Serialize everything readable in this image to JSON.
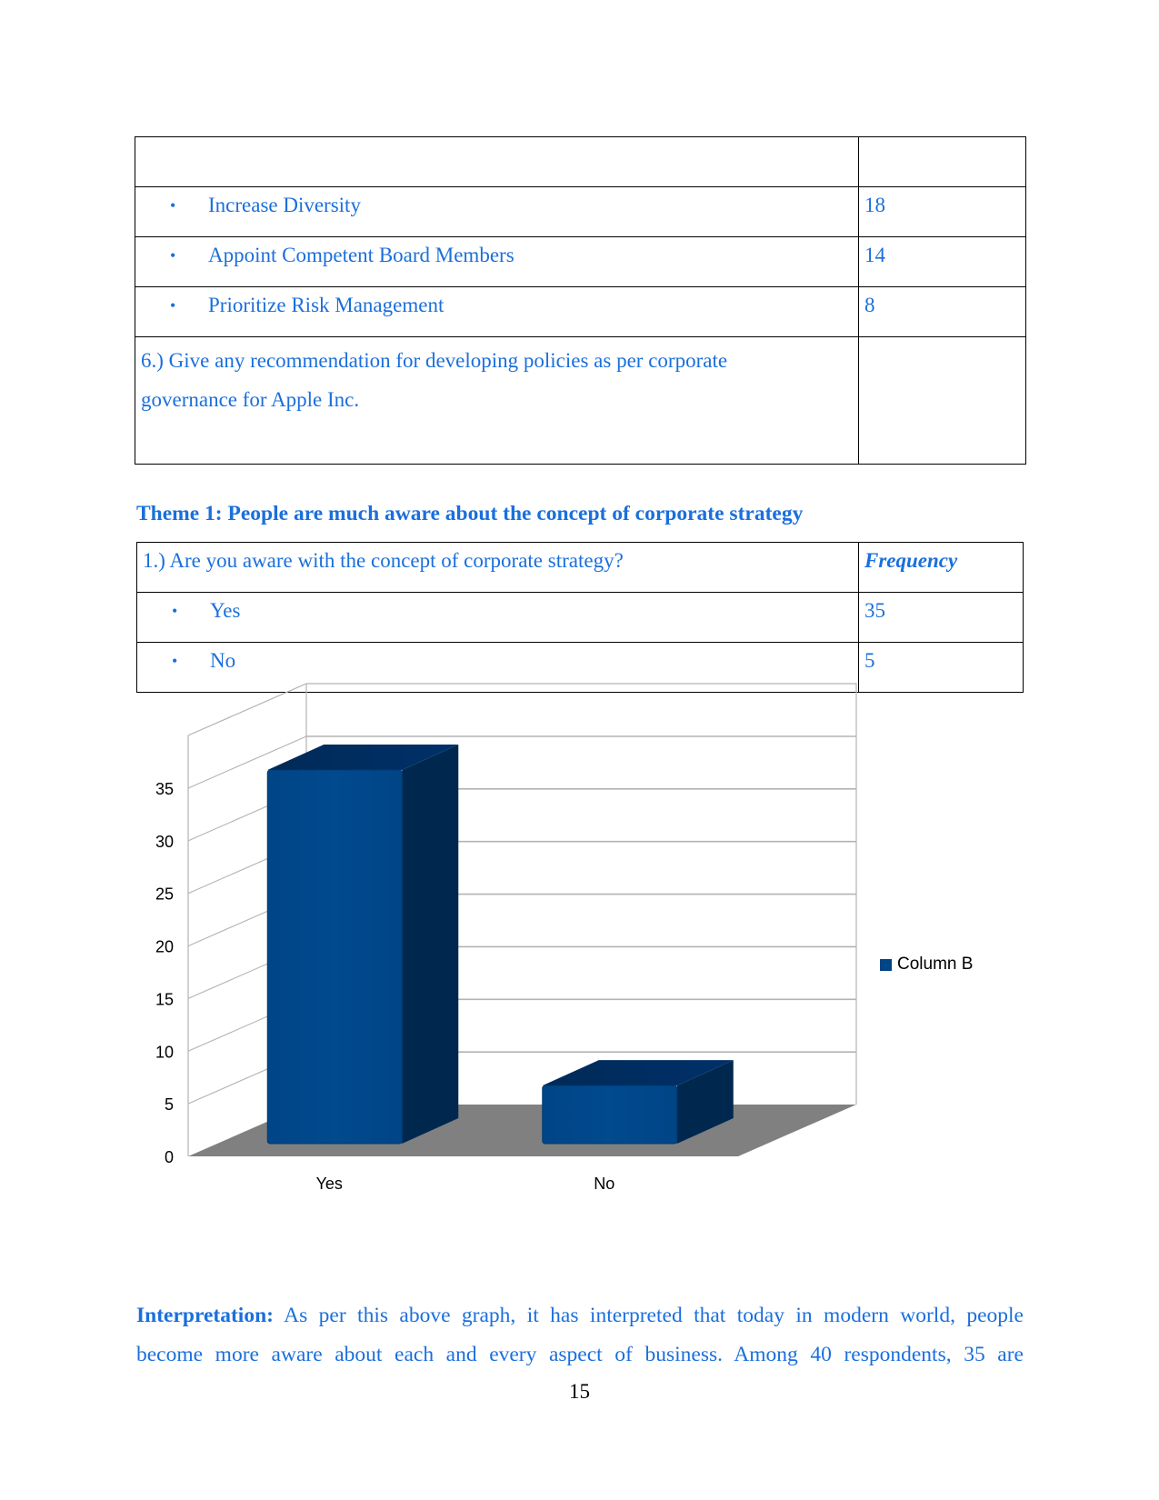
{
  "table1": {
    "rows": [
      {
        "label": "",
        "value": ""
      },
      {
        "label": "Increase Diversity",
        "value": "18",
        "bullet": true
      },
      {
        "label": "Appoint Competent Board Members",
        "value": "14",
        "bullet": true
      },
      {
        "label": "Prioritize Risk Management",
        "value": "8",
        "bullet": true
      }
    ],
    "question6": "6.) Give any recommendation for developing policies as per corporate governance for Apple Inc.",
    "question6_line1": "6.) Give any recommendation for developing policies as per corporate",
    "question6_line2": "governance for Apple Inc.",
    "question6_value": ""
  },
  "theme_heading": "Theme 1: People are much aware about the concept of corporate strategy",
  "table2": {
    "question": "1.) Are you aware with the concept of corporate strategy?",
    "header_value": "Frequency",
    "rows": [
      {
        "label": "Yes",
        "value": "35"
      },
      {
        "label": "No",
        "value": "5"
      }
    ]
  },
  "bullet_glyph": "•",
  "chart_data": {
    "type": "bar",
    "style": "3d-column",
    "categories": [
      "Yes",
      "No"
    ],
    "series": [
      {
        "name": "Column B",
        "values": [
          35,
          5
        ],
        "color": "#004586"
      }
    ],
    "values": [
      35,
      5
    ],
    "title": "",
    "xlabel": "",
    "ylabel": "",
    "ylim": [
      0,
      35
    ],
    "yticks": [
      0,
      5,
      10,
      15,
      20,
      25,
      30,
      35
    ],
    "grid": true,
    "legend": "right",
    "floor_color": "#808080",
    "side_color": "#00284f"
  },
  "interpretation": {
    "label": "Interpretation:",
    "line1": "As per this above graph, it has interpreted that today in modern world, people",
    "line2": "become more aware about each and every aspect of business. Among 40 respondents, 35 are"
  },
  "page_number": "15"
}
